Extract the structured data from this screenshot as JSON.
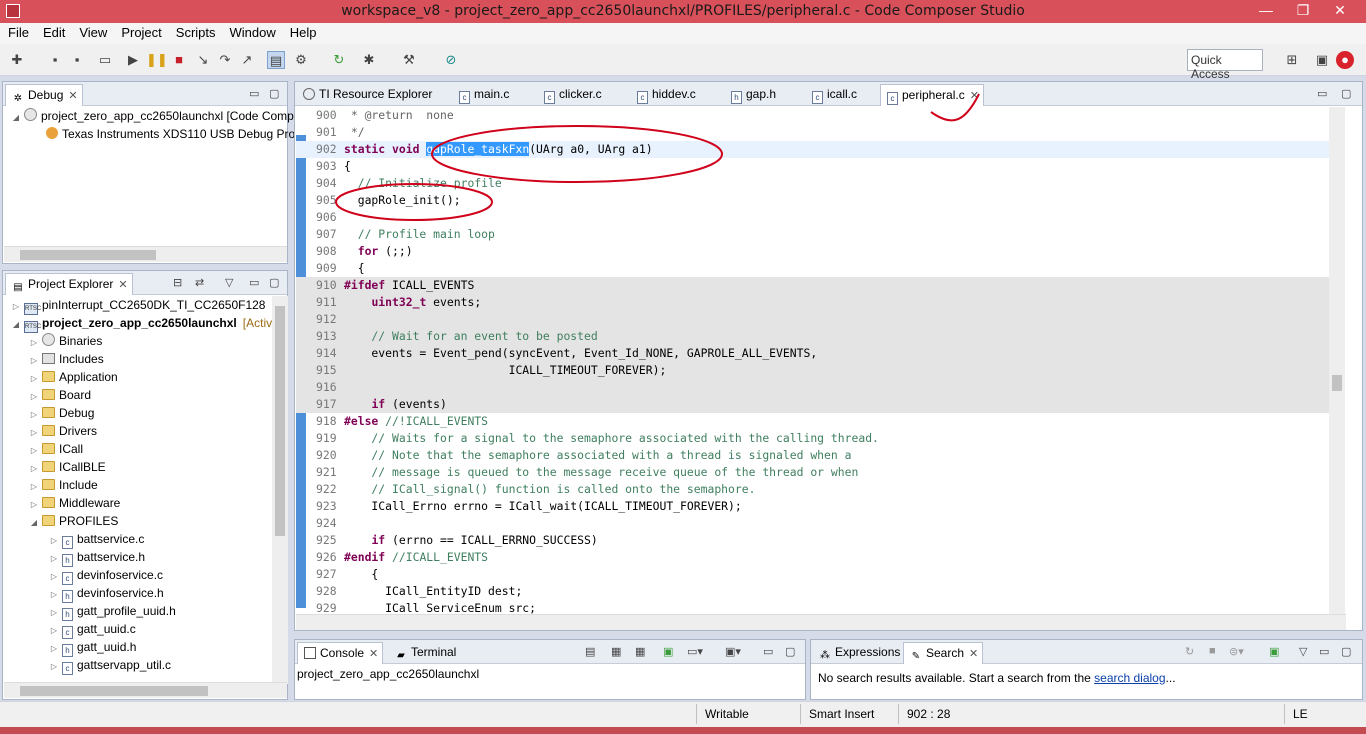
{
  "window": {
    "title": "workspace_v8 - project_zero_app_cc2650launchxl/PROFILES/peripheral.c - Code Composer Studio",
    "minimize": "—",
    "restore": "❐",
    "close": "✕"
  },
  "menu": [
    "File",
    "Edit",
    "View",
    "Project",
    "Scripts",
    "Window",
    "Help"
  ],
  "toolbar": {
    "quick_access": "Quick Access"
  },
  "debug_view": {
    "tab": "Debug",
    "items": [
      {
        "label": "project_zero_app_cc2650launchxl [Code Comp"
      },
      {
        "label": "Texas Instruments XDS110 USB Debug Prol"
      }
    ]
  },
  "project_explorer": {
    "tab": "Project Explorer",
    "items": [
      {
        "label": "pinInterrupt_CC2650DK_TI_CC2650F128",
        "suffix": ""
      },
      {
        "label": "project_zero_app_cc2650launchxl",
        "suffix": "[Activ"
      },
      {
        "label": "Binaries",
        "suffix": ""
      },
      {
        "label": "Includes",
        "suffix": ""
      },
      {
        "label": "Application",
        "suffix": ""
      },
      {
        "label": "Board",
        "suffix": ""
      },
      {
        "label": "Debug",
        "suffix": ""
      },
      {
        "label": "Drivers",
        "suffix": ""
      },
      {
        "label": "ICall",
        "suffix": ""
      },
      {
        "label": "ICallBLE",
        "suffix": ""
      },
      {
        "label": "Include",
        "suffix": ""
      },
      {
        "label": "Middleware",
        "suffix": ""
      },
      {
        "label": "PROFILES",
        "suffix": ""
      },
      {
        "label": "battservice.c",
        "suffix": ""
      },
      {
        "label": "battservice.h",
        "suffix": ""
      },
      {
        "label": "devinfoservice.c",
        "suffix": ""
      },
      {
        "label": "devinfoservice.h",
        "suffix": ""
      },
      {
        "label": "gatt_profile_uuid.h",
        "suffix": ""
      },
      {
        "label": "gatt_uuid.c",
        "suffix": ""
      },
      {
        "label": "gatt_uuid.h",
        "suffix": ""
      },
      {
        "label": "gattservapp_util.c",
        "suffix": ""
      }
    ]
  },
  "editor_tabs": [
    "TI Resource Explorer",
    "main.c",
    "clicker.c",
    "hiddev.c",
    "gap.h",
    "icall.c",
    "peripheral.c"
  ],
  "editor": {
    "lines": [
      {
        "n": "900",
        "t": " * @return  none"
      },
      {
        "n": "901",
        "t": " */"
      },
      {
        "n": "902",
        "t": "static void gapRole_taskFxn(UArg a0, UArg a1)"
      },
      {
        "n": "903",
        "t": "{"
      },
      {
        "n": "904",
        "t": "  // Initialize profile"
      },
      {
        "n": "905",
        "t": "  gapRole_init();"
      },
      {
        "n": "906",
        "t": ""
      },
      {
        "n": "907",
        "t": "  // Profile main loop"
      },
      {
        "n": "908",
        "t": "  for (;;)"
      },
      {
        "n": "909",
        "t": "  {"
      },
      {
        "n": "910",
        "t": "#ifdef ICALL_EVENTS"
      },
      {
        "n": "911",
        "t": "    uint32_t events;"
      },
      {
        "n": "912",
        "t": ""
      },
      {
        "n": "913",
        "t": "    // Wait for an event to be posted"
      },
      {
        "n": "914",
        "t": "    events = Event_pend(syncEvent, Event_Id_NONE, GAPROLE_ALL_EVENTS,"
      },
      {
        "n": "915",
        "t": "                        ICALL_TIMEOUT_FOREVER);"
      },
      {
        "n": "916",
        "t": ""
      },
      {
        "n": "917",
        "t": "    if (events)"
      },
      {
        "n": "918",
        "t": "#else //!ICALL_EVENTS"
      },
      {
        "n": "919",
        "t": "    // Waits for a signal to the semaphore associated with the calling thread."
      },
      {
        "n": "920",
        "t": "    // Note that the semaphore associated with a thread is signaled when a"
      },
      {
        "n": "921",
        "t": "    // message is queued to the message receive queue of the thread or when"
      },
      {
        "n": "922",
        "t": "    // ICall_signal() function is called onto the semaphore."
      },
      {
        "n": "923",
        "t": "    ICall_Errno errno = ICall_wait(ICALL_TIMEOUT_FOREVER);"
      },
      {
        "n": "924",
        "t": ""
      },
      {
        "n": "925",
        "t": "    if (errno == ICALL_ERRNO_SUCCESS)"
      },
      {
        "n": "926",
        "t": "#endif //ICALL_EVENTS"
      },
      {
        "n": "927",
        "t": "    {"
      },
      {
        "n": "928",
        "t": "      ICall_EntityID dest;"
      },
      {
        "n": "929",
        "t": "      ICall_ServiceEnum src;"
      }
    ]
  },
  "console": {
    "tab": "Console",
    "tab2": "Terminal",
    "content": "project_zero_app_cc2650launchxl"
  },
  "search": {
    "tab_expressions": "Expressions",
    "tab_search": "Search",
    "message": "No search results available. Start a search from the",
    "link": "search dialog",
    "suffix": "..."
  },
  "status": {
    "writable": "Writable",
    "insert": "Smart Insert",
    "position": "902 : 28",
    "encoding": "LE"
  }
}
